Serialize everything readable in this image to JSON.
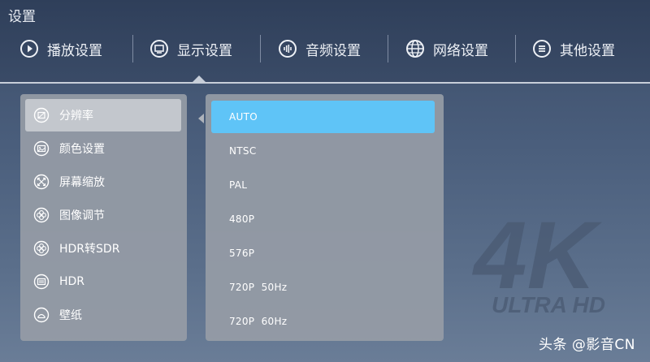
{
  "page_title": "设置",
  "tabs": [
    {
      "label": "播放设置",
      "icon": "play-circle-icon"
    },
    {
      "label": "显示设置",
      "icon": "monitor-icon"
    },
    {
      "label": "音频设置",
      "icon": "audio-wave-icon"
    },
    {
      "label": "网络设置",
      "icon": "globe-icon"
    },
    {
      "label": "其他设置",
      "icon": "menu-lines-icon"
    }
  ],
  "active_tab": "显示设置",
  "menu": [
    {
      "label": "分辨率",
      "icon": "resolution-icon"
    },
    {
      "label": "颜色设置",
      "icon": "image-icon"
    },
    {
      "label": "屏幕缩放",
      "icon": "expand-icon"
    },
    {
      "label": "图像调节",
      "icon": "aperture-icon"
    },
    {
      "label": "HDR转SDR",
      "icon": "aperture-icon"
    },
    {
      "label": "HDR",
      "icon": "hdr-icon"
    },
    {
      "label": "壁纸",
      "icon": "wallpaper-icon"
    }
  ],
  "selected_menu": "分辨率",
  "options": [
    "AUTO",
    "NTSC",
    "PAL",
    "480P",
    "576P",
    "720P  50Hz",
    "720P  60Hz"
  ],
  "selected_option": "AUTO",
  "watermark": {
    "big": "4K",
    "small": "ULTRA HD"
  },
  "brand": "头条 @影音CN",
  "colors": {
    "accent": "#5fc4f7",
    "panel": "#969ca6"
  }
}
